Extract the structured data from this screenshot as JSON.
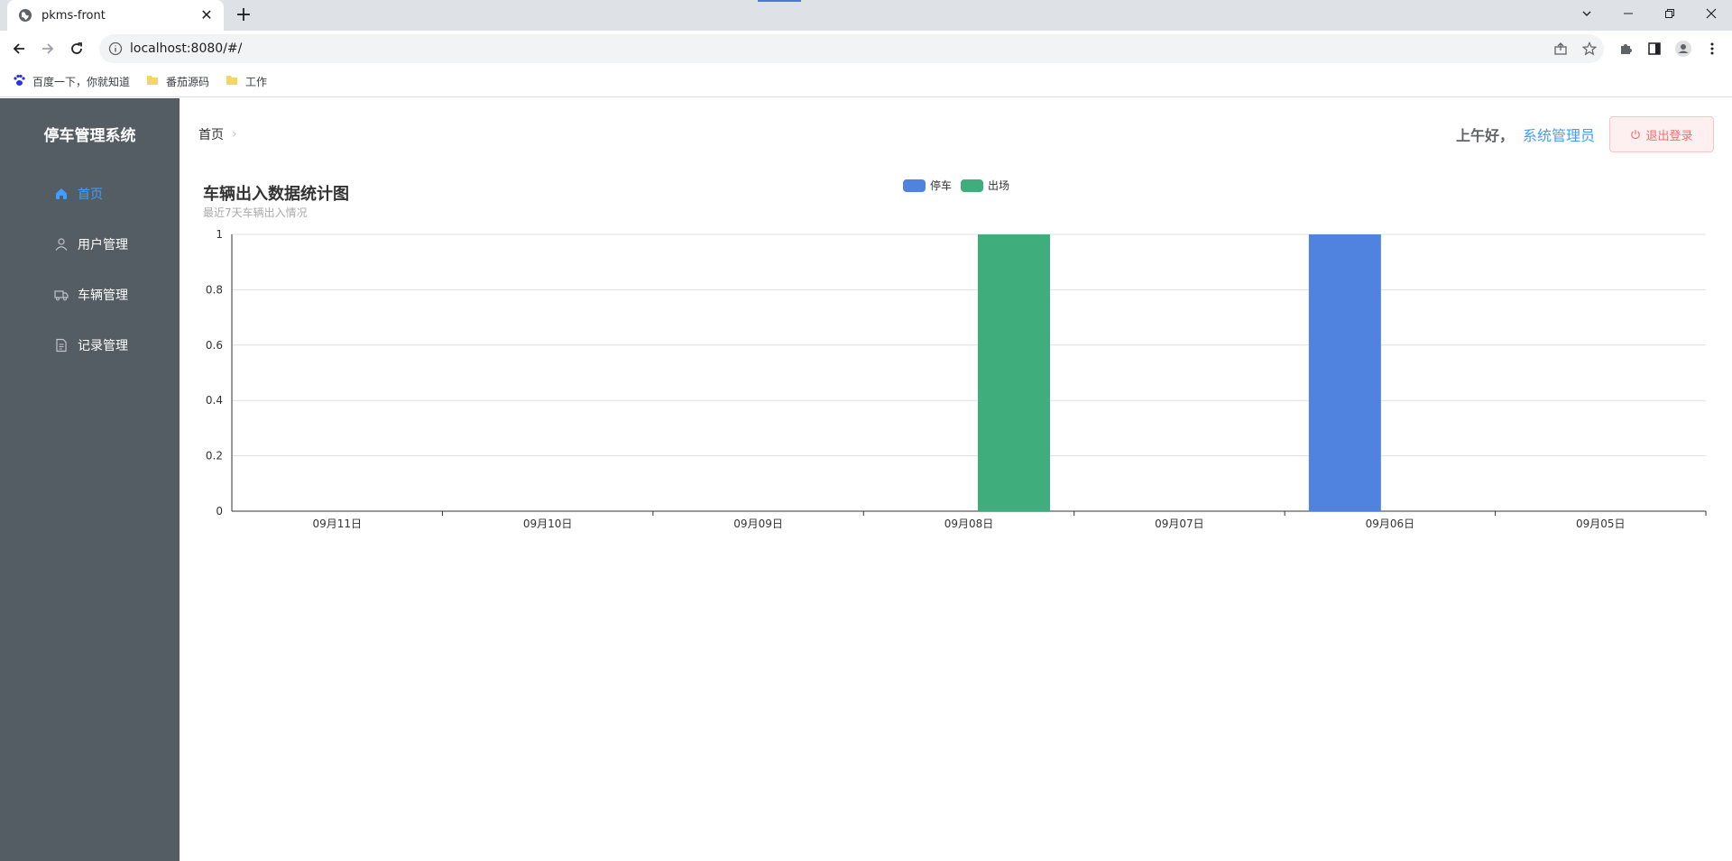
{
  "browser": {
    "tab_title": "pkms-front",
    "tab_close": "✕",
    "new_tab": "+",
    "url": "localhost:8080/#/",
    "bookmarks": [
      {
        "label": "百度一下，你就知道",
        "icon": "baidu-paw-icon"
      },
      {
        "label": "番茄源码",
        "icon": "folder-icon"
      },
      {
        "label": "工作",
        "icon": "folder-icon"
      }
    ]
  },
  "app": {
    "logo": "停车管理系统",
    "menu": [
      {
        "label": "首页",
        "icon": "home-icon",
        "active": true
      },
      {
        "label": "用户管理",
        "icon": "user-icon",
        "active": false
      },
      {
        "label": "车辆管理",
        "icon": "truck-icon",
        "active": false
      },
      {
        "label": "记录管理",
        "icon": "document-icon",
        "active": false
      }
    ],
    "breadcrumb": {
      "home": "首页",
      "separator": "›"
    },
    "greeting": {
      "hello": "上午好，",
      "username": "系统管理员"
    },
    "logout_label": "退出登录"
  },
  "colors": {
    "sidebar_bg": "#545c64",
    "accent": "#409eff",
    "series_parking": "#5083e0",
    "series_exit": "#3fae7c",
    "danger": "#f56c6c"
  },
  "chart_data": {
    "type": "bar",
    "title": "车辆出入数据统计图",
    "subtitle": "最近7天车辆出入情况",
    "categories": [
      "09月11日",
      "09月10日",
      "09月09日",
      "09月08日",
      "09月07日",
      "09月06日",
      "09月05日"
    ],
    "series": [
      {
        "name": "停车",
        "values": [
          0,
          0,
          0,
          0,
          0,
          1,
          0
        ]
      },
      {
        "name": "出场",
        "values": [
          0,
          0,
          0,
          1,
          0,
          0,
          0
        ]
      }
    ],
    "ylim": [
      0,
      1
    ],
    "yticks": [
      "0",
      "0.2",
      "0.4",
      "0.6",
      "0.8",
      "1"
    ],
    "grid": true,
    "legend_position": "top-center"
  }
}
